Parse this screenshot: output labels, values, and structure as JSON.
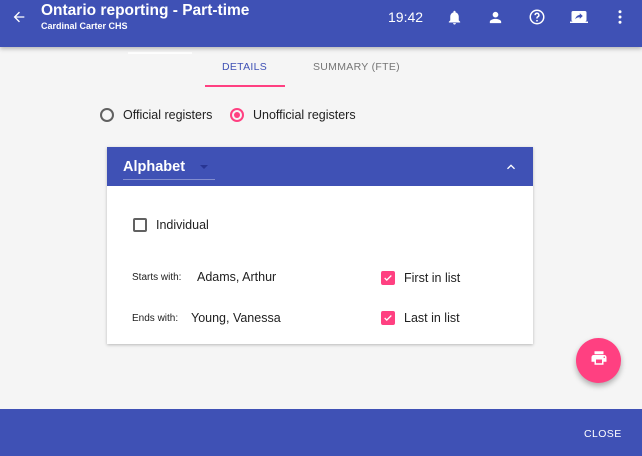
{
  "header": {
    "title": "Ontario reporting - Part-time",
    "subtitle": "Cardinal Carter CHS",
    "time": "19:42",
    "icons": [
      "back-arrow-icon",
      "bell-icon",
      "person-icon",
      "help-icon",
      "screen-share-icon",
      "more-vert-icon"
    ]
  },
  "tabs": [
    {
      "label": "DETAILS",
      "active": true
    },
    {
      "label": "SUMMARY (FTE)",
      "active": false
    }
  ],
  "registers": {
    "options": [
      {
        "label": "Official registers",
        "selected": false
      },
      {
        "label": "Unofficial registers",
        "selected": true
      }
    ]
  },
  "card": {
    "title": "Alphabet",
    "individual": {
      "label": "Individual",
      "checked": false
    },
    "starts_with": {
      "label": "Starts with:",
      "value": "Adams, Arthur",
      "first_label": "First in list",
      "first_checked": true
    },
    "ends_with": {
      "label": "Ends with:",
      "value": "Young, Vanessa",
      "last_label": "Last in list",
      "last_checked": true
    }
  },
  "footer": {
    "close_label": "CLOSE"
  },
  "colors": {
    "primary": "#3f51b5",
    "accent": "#ff4081"
  }
}
